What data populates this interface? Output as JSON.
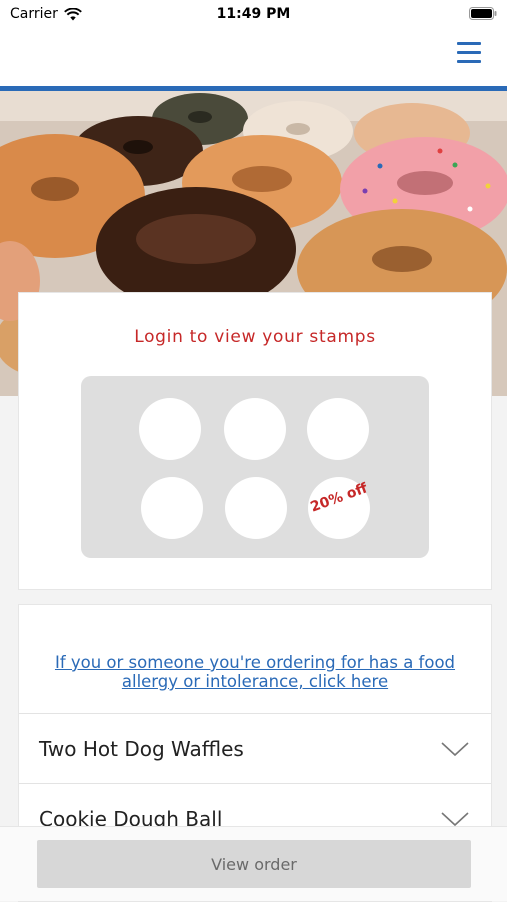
{
  "status_bar": {
    "carrier": "Carrier",
    "time": "11:49 PM"
  },
  "nav": {
    "menu_icon": "hamburger-menu-icon"
  },
  "hero": {
    "image": "donuts-photo"
  },
  "stamps": {
    "title": "Login to view your stamps",
    "total_slots": 6,
    "reward_label": "20% off"
  },
  "allergy_notice": {
    "text": "If you or someone you're ordering for has a food allergy or intolerance, click here"
  },
  "menu_items": [
    {
      "label": "Two Hot Dog Waffles",
      "icon": "chevron-down-icon"
    },
    {
      "label": "Cookie Dough Ball",
      "icon": "chevron-down-icon"
    }
  ],
  "footer": {
    "view_order_label": "View order"
  },
  "colors": {
    "accent": "#2a6ab7",
    "stamp_text": "#c62828",
    "button_bg": "#d7d7d7"
  }
}
